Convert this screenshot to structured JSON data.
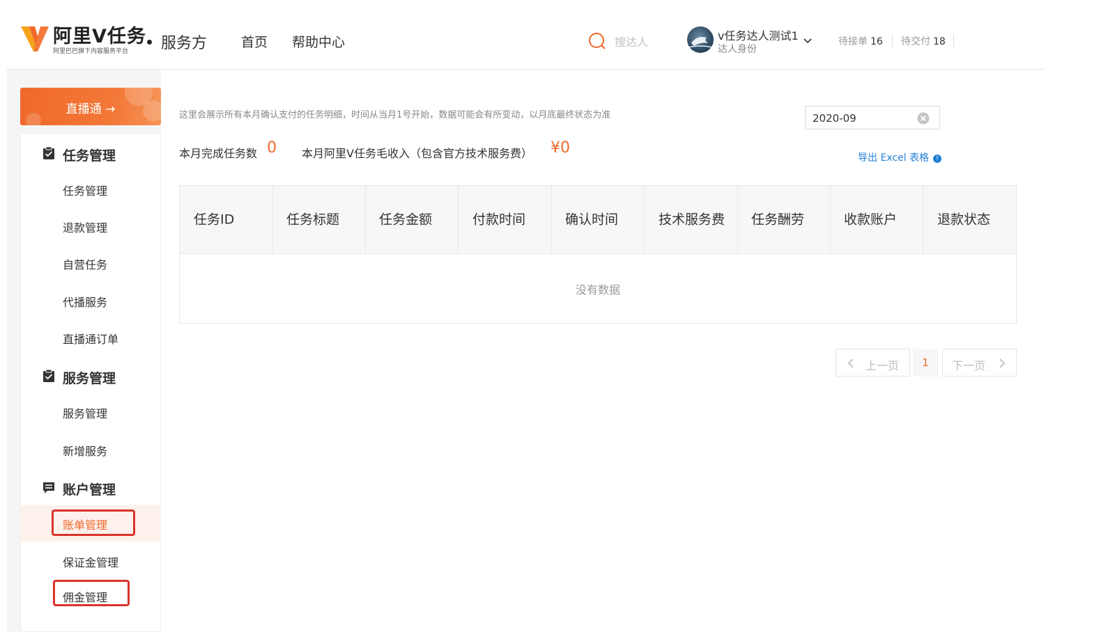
{
  "header": {
    "logo_title": "阿里V任务",
    "logo_subtitle": "阿里巴巴旗下内容服务平台",
    "role": "服务方",
    "nav": [
      "首页",
      "帮助中心"
    ],
    "search_placeholder": "搜达人",
    "user": {
      "name": "v任务达人测试1",
      "identity": "达人身份"
    },
    "stats": [
      {
        "label": "待接单",
        "value": "16"
      },
      {
        "label": "待交付",
        "value": "18"
      }
    ]
  },
  "sidebar": {
    "promo_label": "直播通 →",
    "sections": [
      {
        "title": "任务管理",
        "icon": "clipboard-check-icon",
        "items": [
          "任务管理",
          "退款管理",
          "自营任务",
          "代播服务",
          "直播通订单"
        ]
      },
      {
        "title": "服务管理",
        "icon": "clipboard-check-icon",
        "items": [
          "服务管理",
          "新增服务"
        ]
      },
      {
        "title": "账户管理",
        "icon": "message-box-icon",
        "items": [
          "账单管理",
          "保证金管理",
          "佣金管理"
        ]
      }
    ],
    "active_item": "账单管理"
  },
  "main": {
    "notice": "这里会展示所有本月确认支付的任务明细，时间从当月1号开始，数据可能会有所变动，以月底最终状态为准",
    "month": "2020-09",
    "summary": {
      "completed_label": "本月完成任务数",
      "completed_value": "0",
      "income_label": "本月阿里V任务毛收入（包含官方技术服务费）",
      "income_value": "¥0"
    },
    "export_label": "导出 Excel 表格",
    "table": {
      "columns": [
        "任务ID",
        "任务标题",
        "任务金额",
        "付款时间",
        "确认时间",
        "技术服务费",
        "任务酬劳",
        "收款账户",
        "退款状态"
      ],
      "empty_text": "没有数据"
    },
    "pagination": {
      "prev": "上一页",
      "current": "1",
      "next": "下一页"
    }
  },
  "colors": {
    "accent": "#f0692b",
    "link": "#1f7fd6",
    "highlight": "#d9342b"
  }
}
